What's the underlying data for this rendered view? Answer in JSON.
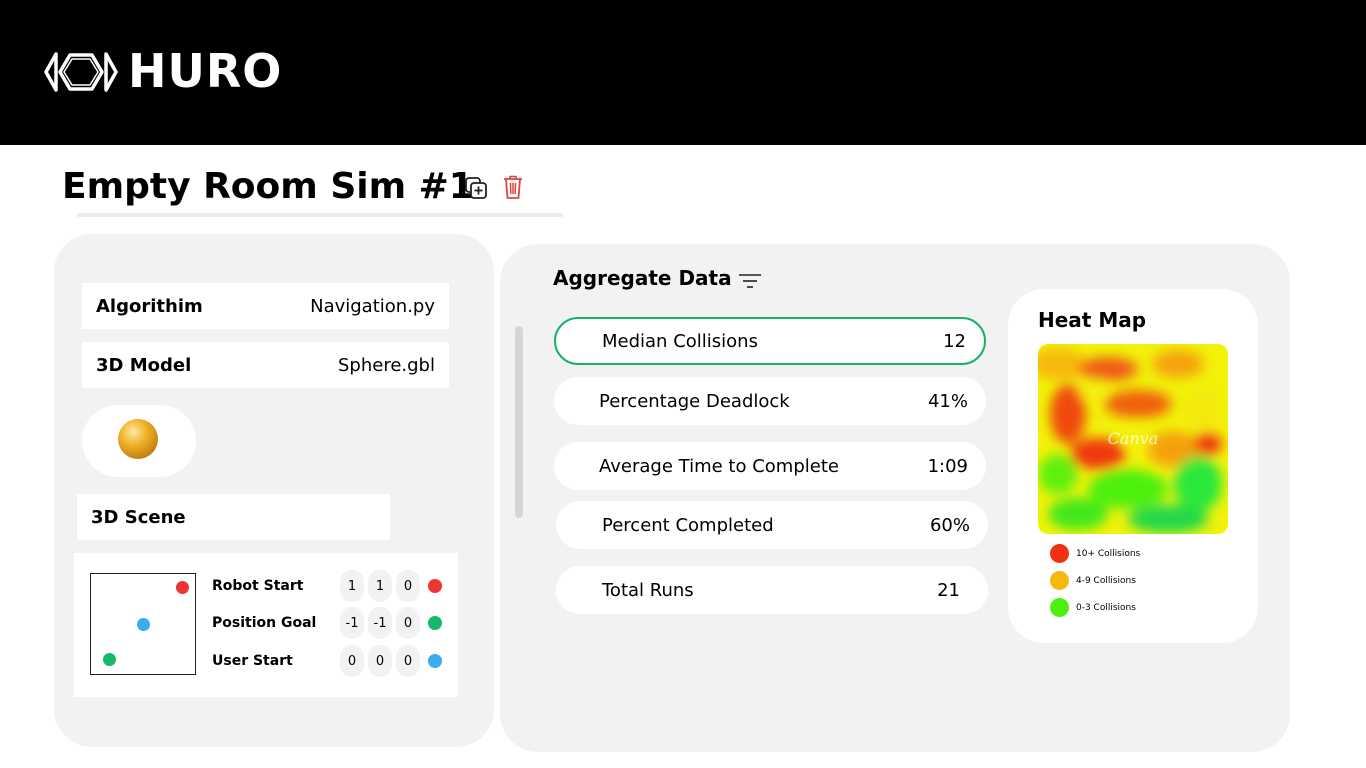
{
  "header": {
    "brand": "HURO"
  },
  "page": {
    "title": "Empty Room Sim #1"
  },
  "config": {
    "algorithm_label": "Algorithim",
    "algorithm_value": "Navigation.py",
    "model_label": "3D Model",
    "model_value": "Sphere.gbl",
    "scene_label": "3D Scene"
  },
  "scene": {
    "rows": [
      {
        "label": "Robot Start",
        "x": "1",
        "y": "1",
        "z": "0",
        "color": "#ef3434"
      },
      {
        "label": "Position Goal",
        "x": "-1",
        "y": "-1",
        "z": "0",
        "color": "#16b86a"
      },
      {
        "label": "User Start",
        "x": "0",
        "y": "0",
        "z": "0",
        "color": "#3aacf0"
      }
    ]
  },
  "aggregate": {
    "title": "Aggregate Data",
    "metrics": [
      {
        "label": "Median Collisions",
        "value": "12"
      },
      {
        "label": "Percentage Deadlock",
        "value": "41%"
      },
      {
        "label": "Average Time to Complete",
        "value": "1:09"
      },
      {
        "label": "Percent Completed",
        "value": "60%"
      },
      {
        "label": "Total Runs",
        "value": "21"
      }
    ]
  },
  "heatmap": {
    "title": "Heat Map",
    "watermark": "Canva",
    "legend": [
      {
        "label": "10+ Collisions",
        "color": "#f3300f"
      },
      {
        "label": "4-9 Collisions",
        "color": "#f7b80c"
      },
      {
        "label": "0-3 Collisions",
        "color": "#4df00c"
      }
    ]
  },
  "colors": {
    "accent_green": "#17b26a",
    "delete_red": "#e0443a",
    "panel_bg": "#f2f2f2",
    "header_bg": "#000000"
  }
}
